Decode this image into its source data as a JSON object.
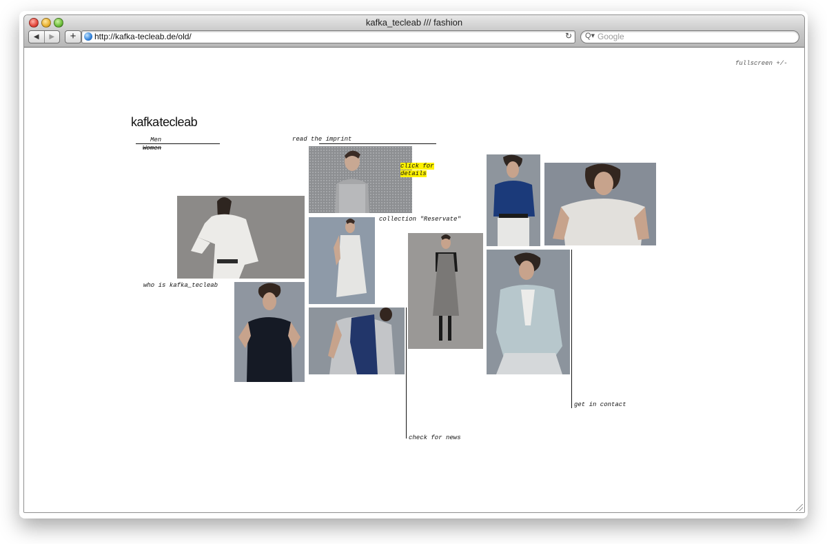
{
  "browser": {
    "title": "kafka_tecleab /// fashion",
    "url": "http://kafka-tecleab.de/old/",
    "search_placeholder": "Google",
    "back_label": "◀",
    "forward_label": "▶",
    "add_label": "+",
    "reload_label": "↻",
    "search_icon_label": "Q▾"
  },
  "page": {
    "fullscreen": "fullscreen +/-",
    "logo_left": "kafka",
    "logo_sep": "∕∕∕",
    "logo_right": "tecleab",
    "nav_men": "Men",
    "nav_women": "Women",
    "imprint": "read the imprint",
    "click_details_1": "click for",
    "click_details_2": "details",
    "collection": "collection \"Reservate\"",
    "who": "who is kafka_tecleab",
    "news": "check for news",
    "contact": "get in contact"
  },
  "colors": {
    "highlight": "#fff200",
    "text": "#111111"
  }
}
